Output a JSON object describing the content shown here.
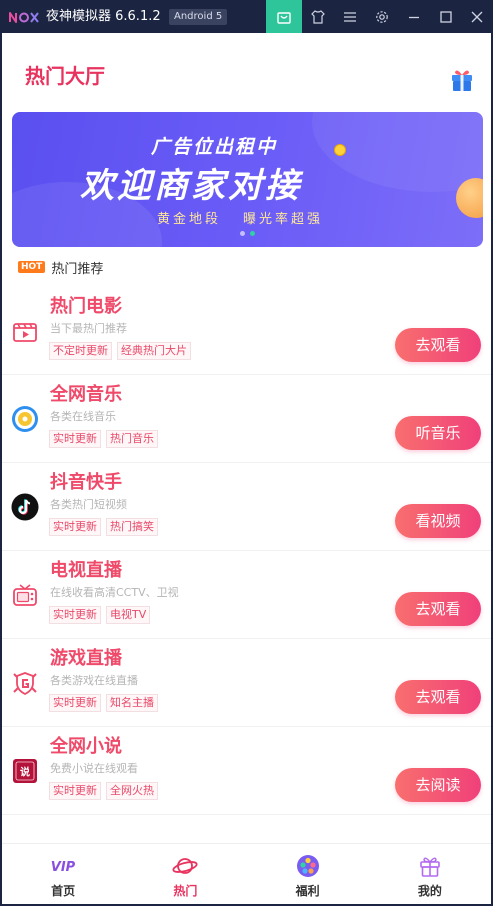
{
  "window": {
    "logo_text": "nox",
    "title": "夜神模拟器 6.6.1.2",
    "android_badge": "Android 5",
    "buttons": [
      "store-icon",
      "shirt-icon",
      "menu-icon",
      "gear-icon",
      "minimize-icon",
      "maximize-icon",
      "close-icon"
    ],
    "accent": "#2fc59a"
  },
  "header": {
    "title": "热门大厅",
    "gift_icon": "gift-icon"
  },
  "banner": {
    "line1": "广告位出租中",
    "line2": "欢迎商家对接",
    "line3a": "黄金地段",
    "line3b": "曝光率超强",
    "slide_count": 2,
    "active_slide": 2
  },
  "section": {
    "hot_badge": "HOT",
    "label": "热门推荐"
  },
  "items": [
    {
      "title": "热门电影",
      "subtitle": "当下最热门推荐",
      "tags": [
        "不定时更新",
        "经典热门大片"
      ],
      "action": "去观看",
      "icon": "movie-clapper-icon"
    },
    {
      "title": "全网音乐",
      "subtitle": "各类在线音乐",
      "tags": [
        "实时更新",
        "热门音乐"
      ],
      "action": "听音乐",
      "icon": "music-disc-icon"
    },
    {
      "title": "抖音快手",
      "subtitle": "各类热门短视频",
      "tags": [
        "实时更新",
        "热门搞笑"
      ],
      "action": "看视频",
      "icon": "tiktok-icon"
    },
    {
      "title": "电视直播",
      "subtitle": "在线收看高清CCTV、卫视",
      "tags": [
        "实时更新",
        "电视TV"
      ],
      "action": "去观看",
      "icon": "tv-icon"
    },
    {
      "title": "游戏直播",
      "subtitle": "各类游戏在线直播",
      "tags": [
        "实时更新",
        "知名主播"
      ],
      "action": "去观看",
      "icon": "game-shield-icon"
    },
    {
      "title": "全网小说",
      "subtitle": "免费小说在线观看",
      "tags": [
        "实时更新",
        "全网火热"
      ],
      "action": "去阅读",
      "icon": "novel-book-icon"
    }
  ],
  "nav": [
    {
      "label": "首页",
      "icon": "vip-icon",
      "active": false
    },
    {
      "label": "热门",
      "icon": "planet-icon",
      "active": true
    },
    {
      "label": "福利",
      "icon": "film-reel-icon",
      "active": false
    },
    {
      "label": "我的",
      "icon": "gift-icon",
      "active": false
    }
  ],
  "colors": {
    "primary": "#e8335f",
    "title_red": "#ef4a6a",
    "button_gradient_start": "#f86f6f",
    "button_gradient_end": "#f0407a"
  }
}
